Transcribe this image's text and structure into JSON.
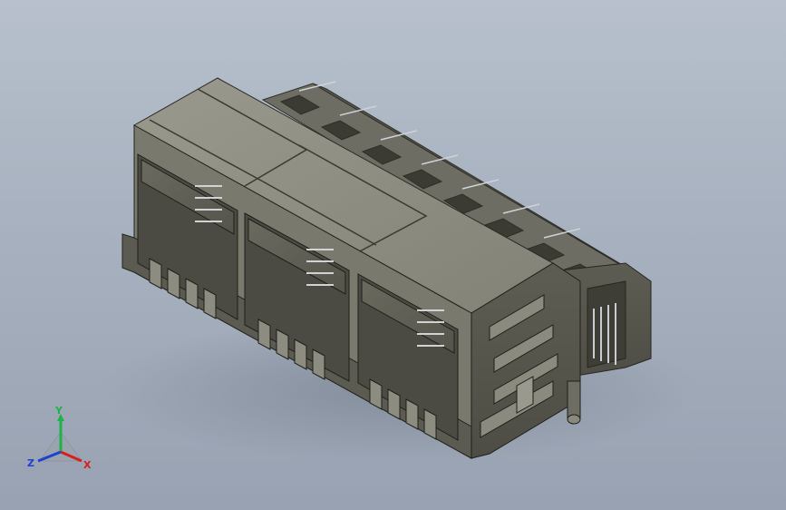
{
  "viewport": {
    "background_top": "#b7c0cc",
    "background_bottom": "#98a2b2"
  },
  "model": {
    "name": "rj45-connector-3port-icon",
    "body_color": "#7c7b6f",
    "top_color": "#8a897d",
    "dark_color": "#4a4a42",
    "port_count": 3
  },
  "triad": {
    "y_label": "Y",
    "x_label": "X",
    "z_label": "Z",
    "y_color": "#1fb24a",
    "x_color": "#d62020",
    "z_color": "#2040d0"
  }
}
